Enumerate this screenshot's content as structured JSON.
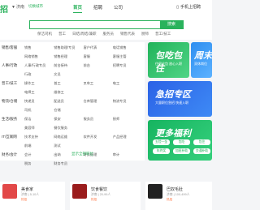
{
  "header": {
    "logo_text": "招",
    "city": "济南",
    "city_sub": "切换城市",
    "nav": [
      "首页",
      "招聘",
      "公司"
    ],
    "phone": "手机上招聘"
  },
  "search": {
    "placeholder": "",
    "button": "搜索",
    "hot_words": [
      "保洁司机",
      "普工",
      "日结/周结/兼职",
      "服务员",
      "销售代表",
      "厨师",
      "普工/技工"
    ]
  },
  "categories": [
    {
      "name": "销售/客服",
      "links": [
        "销售",
        "销售助理/专员",
        "客户代表",
        "电话销售",
        "网络销售",
        "销售经理",
        "客服",
        "客服主管"
      ]
    },
    {
      "name": "人事/行政",
      "links": [
        "人事/行政专员",
        "前台接待",
        "前台",
        "招聘专员",
        "行政",
        "文员",
        "",
        ""
      ]
    },
    {
      "name": "普工/技工",
      "links": [
        "操作工",
        "普工",
        "叉车工",
        "电工",
        "电焊工",
        "维修工",
        "",
        ""
      ]
    },
    {
      "name": "物流/仓储",
      "links": [
        "快递员",
        "配送员",
        "仓库管理",
        "物流专员",
        "司机",
        "仓储",
        "",
        ""
      ]
    },
    {
      "name": "生活/服务",
      "links": [
        "保洁",
        "保安",
        "服务员",
        "厨师",
        "美容师",
        "餐饮服务",
        "",
        ""
      ]
    },
    {
      "name": "IT/互联网",
      "links": [
        "技术支持",
        "网络运维",
        "软件开发",
        "产品经理",
        "前端",
        "测试",
        "",
        ""
      ]
    },
    {
      "name": "财务/会计",
      "links": [
        "会计",
        "出纳",
        "财务经理",
        "审计",
        "税务",
        "财务专员",
        "",
        ""
      ]
    }
  ],
  "more_categories": "显示全部职位",
  "banners": {
    "b1": {
      "title": "包吃包住",
      "sub": "住宿全包 放心入职"
    },
    "b2": {
      "title": "周末",
      "sub": "双休岗位"
    },
    "b3": {
      "title": "急招专区",
      "sub": "大量职位急招 快速入职"
    },
    "b4": {
      "title": "更多福利",
      "pills": [
        "五险一金",
        "包吃",
        "包住",
        "年终奖",
        "加班补助",
        "交通补助"
      ]
    }
  },
  "cards": [
    {
      "title": "美食家",
      "sub": "济南 | 5-10人",
      "tag": "热招"
    },
    {
      "title": "饮食餐饮",
      "sub": "济南 | 20-99人",
      "tag": "热招"
    },
    {
      "title": "巴奴毛肚",
      "sub": "济南 | 100-499人",
      "tag": "热招"
    }
  ]
}
